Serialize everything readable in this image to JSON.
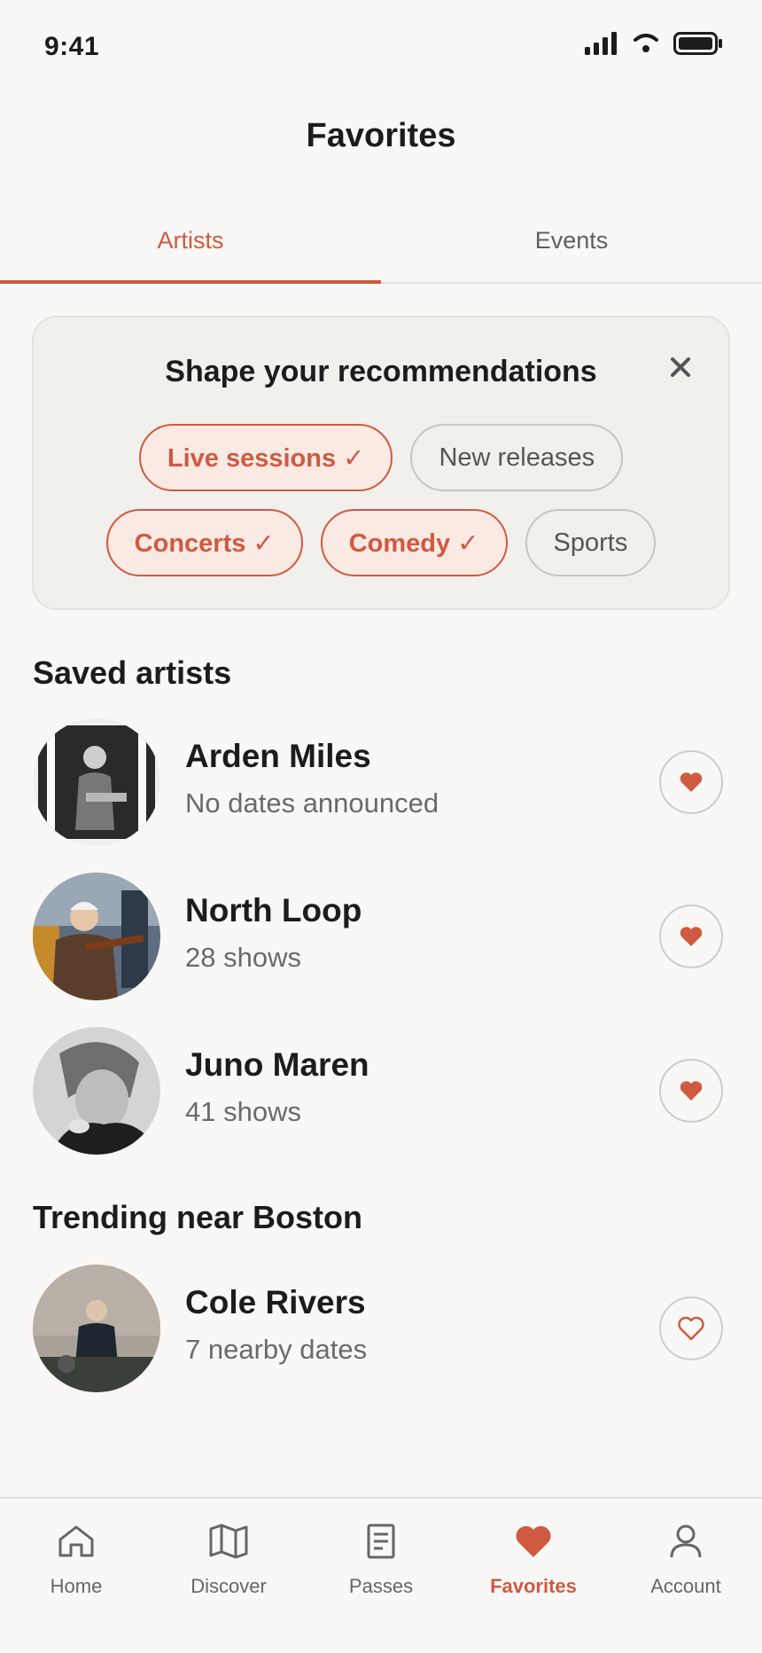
{
  "status": {
    "time": "9:41"
  },
  "title": "Favorites",
  "tabs": [
    {
      "label": "Artists"
    },
    {
      "label": "Events"
    }
  ],
  "recommendations": {
    "title": "Shape your recommendations",
    "chips": [
      {
        "label": "Live sessions ✓",
        "selected": true
      },
      {
        "label": "New releases",
        "selected": false
      },
      {
        "label": "Concerts ✓",
        "selected": true
      },
      {
        "label": "Comedy ✓",
        "selected": true
      },
      {
        "label": "Sports",
        "selected": false
      }
    ]
  },
  "saved": {
    "title": "Saved artists",
    "artists": [
      {
        "name": "Arden Miles",
        "sub": "No dates announced",
        "favorited": true
      },
      {
        "name": "North Loop",
        "sub": "28 shows",
        "favorited": true
      },
      {
        "name": "Juno Maren",
        "sub": "41 shows",
        "favorited": true
      }
    ]
  },
  "trending": {
    "title": "Trending near Boston",
    "artists": [
      {
        "name": "Cole Rivers",
        "sub": "7 nearby dates",
        "favorited": false
      }
    ]
  },
  "nav": {
    "items": [
      {
        "label": "Home",
        "icon": "home-icon"
      },
      {
        "label": "Discover",
        "icon": "map-icon"
      },
      {
        "label": "Passes",
        "icon": "ticket-icon"
      },
      {
        "label": "Favorites",
        "icon": "heart-icon",
        "active": true
      },
      {
        "label": "Account",
        "icon": "person-icon"
      }
    ]
  },
  "colors": {
    "accent": "#cf5a40",
    "background": "#faf8f6",
    "card": "#f2f0ed"
  }
}
